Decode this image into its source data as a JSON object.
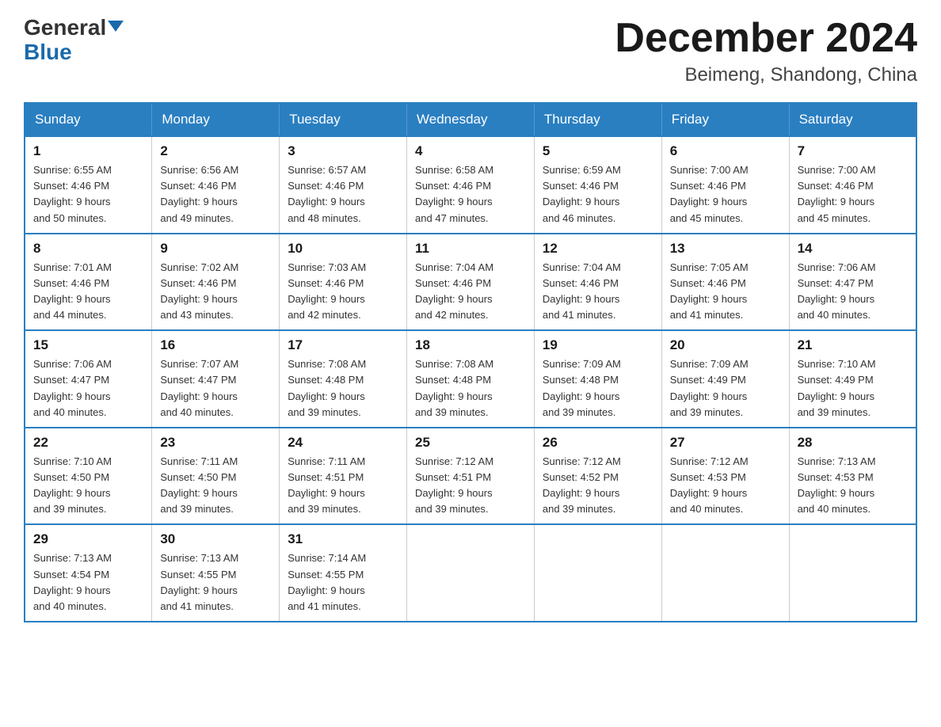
{
  "header": {
    "logo_general": "General",
    "logo_blue": "Blue",
    "month_title": "December 2024",
    "location": "Beimeng, Shandong, China"
  },
  "weekdays": [
    "Sunday",
    "Monday",
    "Tuesday",
    "Wednesday",
    "Thursday",
    "Friday",
    "Saturday"
  ],
  "weeks": [
    [
      {
        "day": "1",
        "sunrise": "6:55 AM",
        "sunset": "4:46 PM",
        "daylight": "9 hours and 50 minutes."
      },
      {
        "day": "2",
        "sunrise": "6:56 AM",
        "sunset": "4:46 PM",
        "daylight": "9 hours and 49 minutes."
      },
      {
        "day": "3",
        "sunrise": "6:57 AM",
        "sunset": "4:46 PM",
        "daylight": "9 hours and 48 minutes."
      },
      {
        "day": "4",
        "sunrise": "6:58 AM",
        "sunset": "4:46 PM",
        "daylight": "9 hours and 47 minutes."
      },
      {
        "day": "5",
        "sunrise": "6:59 AM",
        "sunset": "4:46 PM",
        "daylight": "9 hours and 46 minutes."
      },
      {
        "day": "6",
        "sunrise": "7:00 AM",
        "sunset": "4:46 PM",
        "daylight": "9 hours and 45 minutes."
      },
      {
        "day": "7",
        "sunrise": "7:00 AM",
        "sunset": "4:46 PM",
        "daylight": "9 hours and 45 minutes."
      }
    ],
    [
      {
        "day": "8",
        "sunrise": "7:01 AM",
        "sunset": "4:46 PM",
        "daylight": "9 hours and 44 minutes."
      },
      {
        "day": "9",
        "sunrise": "7:02 AM",
        "sunset": "4:46 PM",
        "daylight": "9 hours and 43 minutes."
      },
      {
        "day": "10",
        "sunrise": "7:03 AM",
        "sunset": "4:46 PM",
        "daylight": "9 hours and 42 minutes."
      },
      {
        "day": "11",
        "sunrise": "7:04 AM",
        "sunset": "4:46 PM",
        "daylight": "9 hours and 42 minutes."
      },
      {
        "day": "12",
        "sunrise": "7:04 AM",
        "sunset": "4:46 PM",
        "daylight": "9 hours and 41 minutes."
      },
      {
        "day": "13",
        "sunrise": "7:05 AM",
        "sunset": "4:46 PM",
        "daylight": "9 hours and 41 minutes."
      },
      {
        "day": "14",
        "sunrise": "7:06 AM",
        "sunset": "4:47 PM",
        "daylight": "9 hours and 40 minutes."
      }
    ],
    [
      {
        "day": "15",
        "sunrise": "7:06 AM",
        "sunset": "4:47 PM",
        "daylight": "9 hours and 40 minutes."
      },
      {
        "day": "16",
        "sunrise": "7:07 AM",
        "sunset": "4:47 PM",
        "daylight": "9 hours and 40 minutes."
      },
      {
        "day": "17",
        "sunrise": "7:08 AM",
        "sunset": "4:48 PM",
        "daylight": "9 hours and 39 minutes."
      },
      {
        "day": "18",
        "sunrise": "7:08 AM",
        "sunset": "4:48 PM",
        "daylight": "9 hours and 39 minutes."
      },
      {
        "day": "19",
        "sunrise": "7:09 AM",
        "sunset": "4:48 PM",
        "daylight": "9 hours and 39 minutes."
      },
      {
        "day": "20",
        "sunrise": "7:09 AM",
        "sunset": "4:49 PM",
        "daylight": "9 hours and 39 minutes."
      },
      {
        "day": "21",
        "sunrise": "7:10 AM",
        "sunset": "4:49 PM",
        "daylight": "9 hours and 39 minutes."
      }
    ],
    [
      {
        "day": "22",
        "sunrise": "7:10 AM",
        "sunset": "4:50 PM",
        "daylight": "9 hours and 39 minutes."
      },
      {
        "day": "23",
        "sunrise": "7:11 AM",
        "sunset": "4:50 PM",
        "daylight": "9 hours and 39 minutes."
      },
      {
        "day": "24",
        "sunrise": "7:11 AM",
        "sunset": "4:51 PM",
        "daylight": "9 hours and 39 minutes."
      },
      {
        "day": "25",
        "sunrise": "7:12 AM",
        "sunset": "4:51 PM",
        "daylight": "9 hours and 39 minutes."
      },
      {
        "day": "26",
        "sunrise": "7:12 AM",
        "sunset": "4:52 PM",
        "daylight": "9 hours and 39 minutes."
      },
      {
        "day": "27",
        "sunrise": "7:12 AM",
        "sunset": "4:53 PM",
        "daylight": "9 hours and 40 minutes."
      },
      {
        "day": "28",
        "sunrise": "7:13 AM",
        "sunset": "4:53 PM",
        "daylight": "9 hours and 40 minutes."
      }
    ],
    [
      {
        "day": "29",
        "sunrise": "7:13 AM",
        "sunset": "4:54 PM",
        "daylight": "9 hours and 40 minutes."
      },
      {
        "day": "30",
        "sunrise": "7:13 AM",
        "sunset": "4:55 PM",
        "daylight": "9 hours and 41 minutes."
      },
      {
        "day": "31",
        "sunrise": "7:14 AM",
        "sunset": "4:55 PM",
        "daylight": "9 hours and 41 minutes."
      },
      null,
      null,
      null,
      null
    ]
  ],
  "labels": {
    "sunrise": "Sunrise:",
    "sunset": "Sunset:",
    "daylight": "Daylight:"
  }
}
